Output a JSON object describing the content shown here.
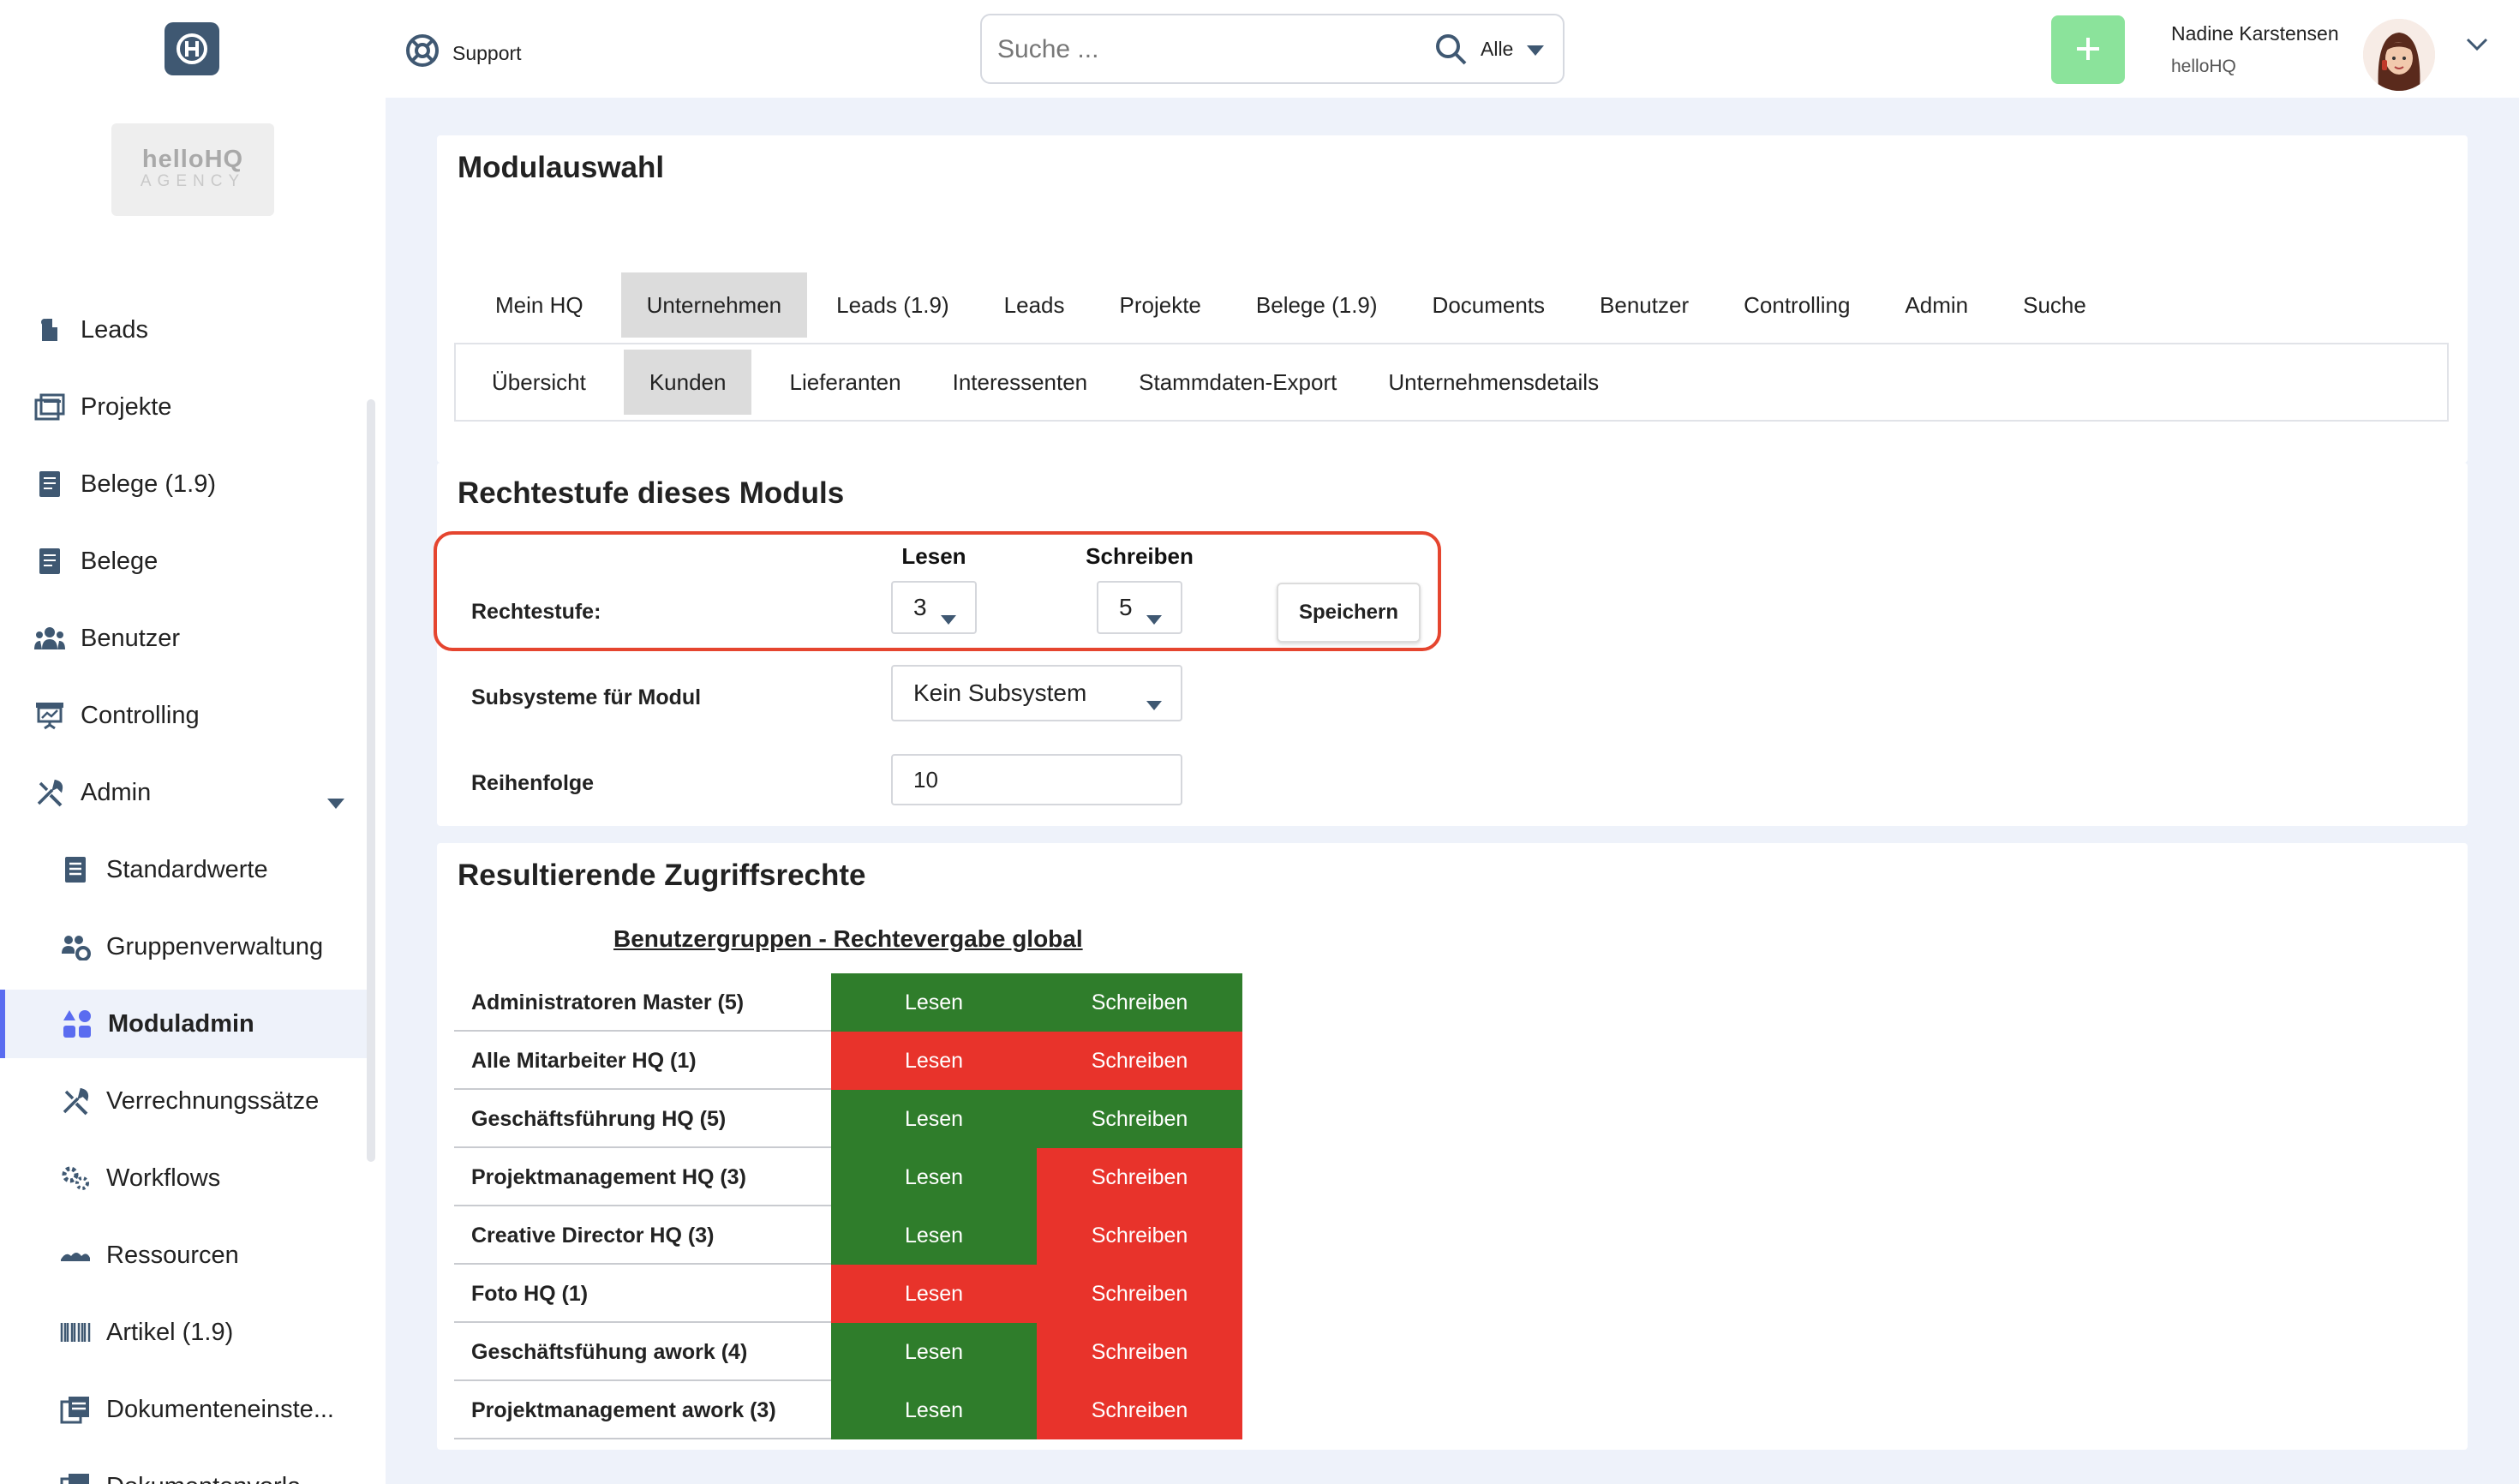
{
  "colors": {
    "granted": "#2f7d2b",
    "denied": "#e8332b",
    "accent": "#5a6cf0",
    "highlight": "#e5452f",
    "add_button": "#8be39b"
  },
  "header": {
    "logo_icon": "h-logo-icon",
    "support_label": "Support",
    "search": {
      "placeholder": "Suche ...",
      "scope": "Alle"
    },
    "user": {
      "name": "Nadine Karstensen",
      "org": "helloHQ"
    }
  },
  "sidebar": {
    "agency_logo": {
      "line1": "helloHQ",
      "line2": "AGENCY"
    },
    "items": [
      {
        "label": "Leads",
        "icon": "leads-icon"
      },
      {
        "label": "Projekte",
        "icon": "projects-icon"
      },
      {
        "label": "Belege (1.9)",
        "icon": "document-icon"
      },
      {
        "label": "Belege",
        "icon": "document-icon"
      },
      {
        "label": "Benutzer",
        "icon": "users-icon"
      },
      {
        "label": "Controlling",
        "icon": "controlling-icon"
      },
      {
        "label": "Admin",
        "icon": "tools-icon"
      }
    ],
    "admin_children": [
      {
        "label": "Standardwerte",
        "icon": "defaults-icon"
      },
      {
        "label": "Gruppenverwaltung",
        "icon": "group-settings-icon"
      },
      {
        "label": "Moduladmin",
        "icon": "modules-icon",
        "active": true
      },
      {
        "label": "Verrechnungssätze",
        "icon": "tools-icon"
      },
      {
        "label": "Workflows",
        "icon": "gears-icon"
      },
      {
        "label": "Ressourcen",
        "icon": "resources-icon"
      },
      {
        "label": "Artikel (1.9)",
        "icon": "barcode-icon"
      },
      {
        "label": "Dokumenteneinste...",
        "icon": "document-settings-icon"
      },
      {
        "label": "Dokumentenvorla...",
        "icon": "document-template-icon"
      }
    ]
  },
  "module_selection": {
    "title": "Modulauswahl",
    "tabs": [
      "Mein HQ",
      "Unternehmen",
      "Leads (1.9)",
      "Leads",
      "Projekte",
      "Belege (1.9)",
      "Documents",
      "Benutzer",
      "Controlling",
      "Admin",
      "Suche"
    ],
    "active_tab": "Unternehmen",
    "subtabs": [
      "Übersicht",
      "Kunden",
      "Lieferanten",
      "Interessenten",
      "Stammdaten-Export",
      "Unternehmensdetails"
    ],
    "active_subtab": "Kunden"
  },
  "rights_level": {
    "title": "Rechtestufe dieses Moduls",
    "label": "Rechtestufe:",
    "read_header": "Lesen",
    "write_header": "Schreiben",
    "read_value": "3",
    "write_value": "5",
    "save_label": "Speichern",
    "subsystem_label": "Subsysteme für Modul",
    "subsystem_value": "Kein Subsystem",
    "order_label": "Reihenfolge",
    "order_value": "10"
  },
  "access_rights": {
    "title": "Resultierende Zugriffsrechte",
    "subtitle": "Benutzergruppen - Rechtevergabe global",
    "read_label": "Lesen",
    "write_label": "Schreiben",
    "groups": [
      {
        "name": "Administratoren Master (5)",
        "read": true,
        "write": true
      },
      {
        "name": "Alle Mitarbeiter HQ (1)",
        "read": false,
        "write": false
      },
      {
        "name": "Geschäftsführung HQ (5)",
        "read": true,
        "write": true
      },
      {
        "name": "Projektmanagement HQ (3)",
        "read": true,
        "write": false
      },
      {
        "name": "Creative Director HQ (3)",
        "read": true,
        "write": false
      },
      {
        "name": "Foto HQ (1)",
        "read": false,
        "write": false
      },
      {
        "name": "Geschäftsfühung awork (4)",
        "read": true,
        "write": false
      },
      {
        "name": "Projektmanagement awork (3)",
        "read": true,
        "write": false
      }
    ]
  }
}
